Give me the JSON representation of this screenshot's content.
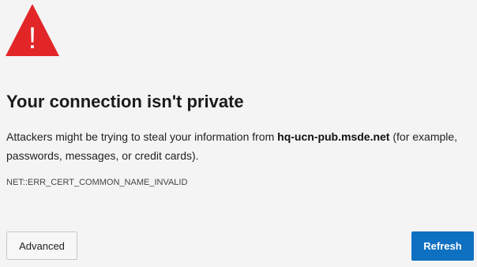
{
  "page": {
    "title": "Your connection isn't private",
    "description": {
      "before": "Attackers might be trying to steal your information from ",
      "host": "hq-ucn-pub.msde.net",
      "after": " (for example, passwords, messages, or credit cards)."
    },
    "error_code": "NET::ERR_CERT_COMMON_NAME_INVALID"
  },
  "buttons": {
    "advanced_label": "Advanced",
    "refresh_label": "Refresh"
  },
  "icons": {
    "warning": {
      "name": "warning-triangle-icon",
      "glyph": "!",
      "color": "#e22627"
    }
  },
  "colors": {
    "background": "#f4f4f4",
    "accent": "#0e70c0",
    "warning": "#e22627"
  }
}
